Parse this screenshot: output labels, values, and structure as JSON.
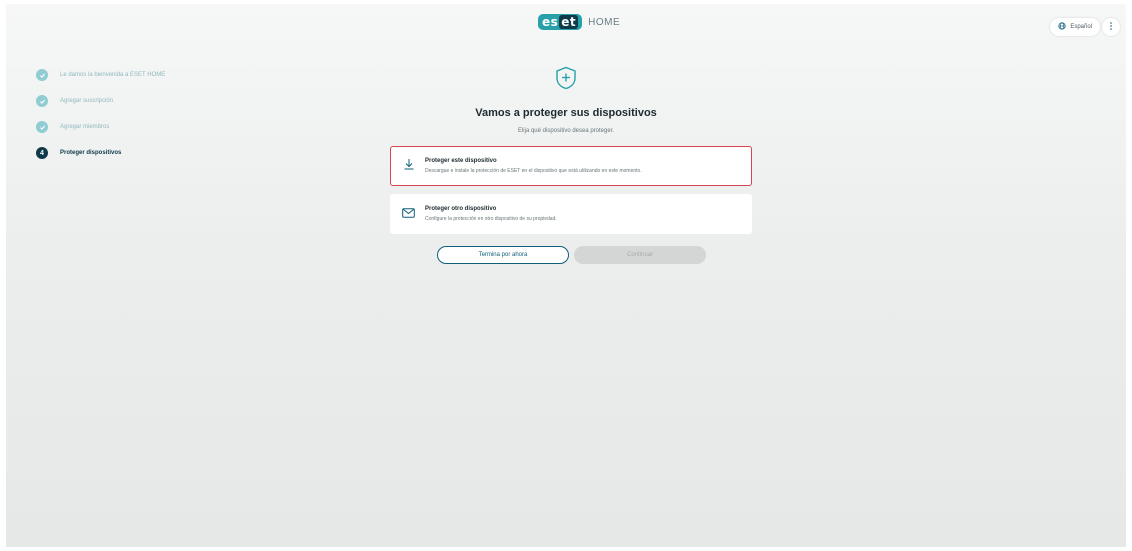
{
  "header": {
    "logo_text": "eset",
    "logo_suffix": "HOME",
    "language": "Español",
    "language_icon": "globe-icon",
    "more_icon": "more-vertical-icon"
  },
  "steps": [
    {
      "label": "Le damos la bienvenida a ESET HOME",
      "state": "done"
    },
    {
      "label": "Agregar suscripción",
      "state": "done"
    },
    {
      "label": "Agregar miembros",
      "state": "done"
    },
    {
      "label": "Proteger dispositivos",
      "state": "current",
      "number": "4"
    }
  ],
  "main": {
    "icon": "shield-plus-icon",
    "title": "Vamos a proteger sus dispositivos",
    "subtitle": "Elija qué dispositivo desea proteger.",
    "options": [
      {
        "title": "Proteger este dispositivo",
        "description": "Descargue e instale la protección de ESET en el dispositivo que está utilizando en este momento.",
        "icon": "download-icon",
        "selected": true
      },
      {
        "title": "Proteger otro dispositivo",
        "description": "Configure la protección en otro dispositivo de su propiedad.",
        "icon": "mail-icon",
        "selected": false
      }
    ],
    "finish_label": "Termina por ahora",
    "continue_label": "Continuar"
  },
  "colors": {
    "accent": "#27a0a8",
    "step_done": "#8fcdd2",
    "step_current": "#0f3a4a",
    "selected_border": "#d64550",
    "button_outline": "#0f5e7a"
  }
}
